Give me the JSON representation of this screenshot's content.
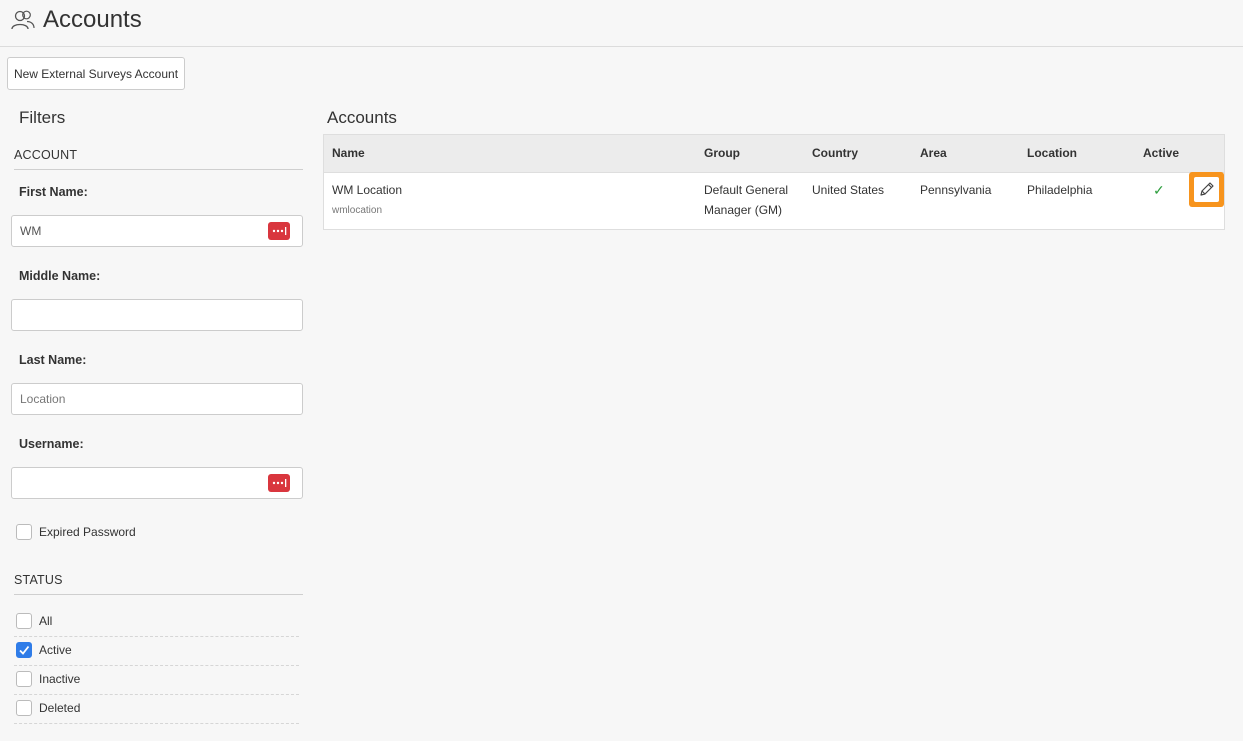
{
  "header": {
    "title": "Accounts",
    "icon": "users-icon"
  },
  "toolbar": {
    "new_button": "New External Surveys Account"
  },
  "filters": {
    "title": "Filters",
    "account_section": "ACCOUNT",
    "first_name": {
      "label": "First Name:",
      "value": "WM",
      "placeholder": ""
    },
    "middle_name": {
      "label": "Middle Name:",
      "value": "",
      "placeholder": ""
    },
    "last_name": {
      "label": "Last Name:",
      "value": "",
      "placeholder": "Location"
    },
    "username": {
      "label": "Username:",
      "value": "",
      "placeholder": ""
    },
    "expired_password": {
      "label": "Expired Password",
      "checked": false
    },
    "status_section": "STATUS",
    "status": [
      {
        "label": "All",
        "checked": false
      },
      {
        "label": "Active",
        "checked": true
      },
      {
        "label": "Inactive",
        "checked": false
      },
      {
        "label": "Deleted",
        "checked": false
      }
    ]
  },
  "accounts": {
    "title": "Accounts",
    "columns": [
      "Name",
      "Group",
      "Country",
      "Area",
      "Location",
      "Active"
    ],
    "rows": [
      {
        "name": "WM Location",
        "username": "wmlocation",
        "group_line1": "Default General",
        "group_line2": "Manager (GM)",
        "country": "United States",
        "area": "Pennsylvania",
        "location": "Philadelphia",
        "active": "✓"
      }
    ]
  },
  "colors": {
    "accent_blue": "#2f7ce8",
    "edit_orange": "#f7941d",
    "password_red": "#d9363e",
    "active_green": "#2e9e3e"
  }
}
